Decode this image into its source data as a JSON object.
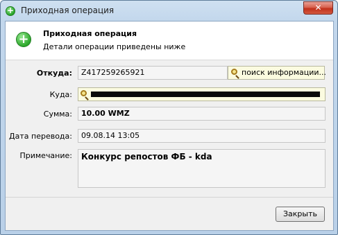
{
  "window": {
    "title": "Приходная операция",
    "close_glyph": "✕"
  },
  "header": {
    "title": "Приходная операция",
    "subtitle": "Детали операции приведены ниже",
    "icon": "green-plus-icon"
  },
  "form": {
    "from_label": "Откуда:",
    "from_value": "Z417259265921",
    "lookup_label": "поиск информации...",
    "to_label": "Куда:",
    "amount_label": "Сумма:",
    "amount_value": "10.00 WMZ",
    "date_label": "Дата перевода:",
    "date_value": "09.08.14 13:05",
    "note_label": "Примечание:",
    "note_value": "Конкурс репостов ФБ - kda"
  },
  "footer": {
    "close_label": "Закрыть"
  },
  "colors": {
    "accent_green": "#2aa52b",
    "lookup_bg": "#fbfbe0"
  }
}
